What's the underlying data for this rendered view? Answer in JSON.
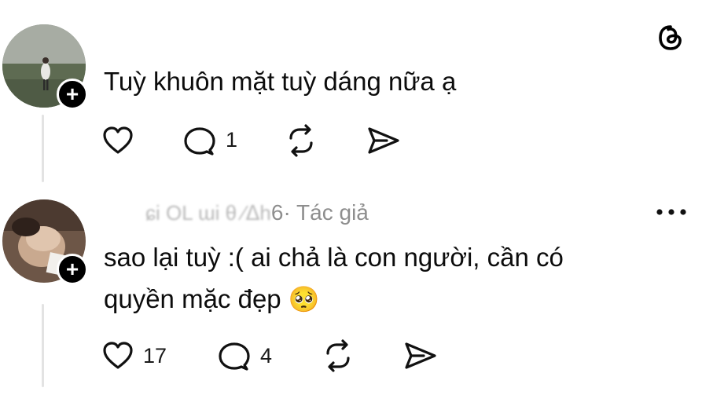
{
  "comments": [
    {
      "text": "Tuỳ khuôn mặt tuỳ dáng nữa ạ",
      "actions": {
        "like_count": "",
        "reply_count": "1"
      }
    },
    {
      "username_obscured": "ɕi   OL   ɯi θ  ⁄ᐃh",
      "username_tail": "6",
      "author_badge": " · Tác giả",
      "text_line1": "sao lại tuỳ :( ai chả là con người, cần có",
      "text_line2": "quyền mặc đẹp",
      "emoji": "🥺",
      "actions": {
        "like_count": "17",
        "reply_count": "4"
      }
    }
  ],
  "icons": {
    "app_logo": "threads-logo-icon",
    "like": "heart-icon",
    "reply": "comment-icon",
    "repost": "repost-icon",
    "share": "send-icon",
    "follow": "plus-icon",
    "more": "more-icon"
  }
}
